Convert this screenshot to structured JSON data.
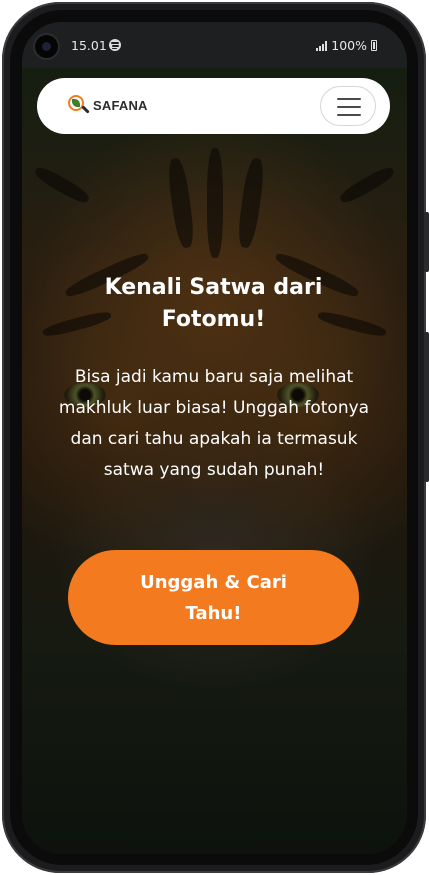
{
  "status_bar": {
    "time": "15.01",
    "battery": "100%",
    "icons": [
      "spotify-icon",
      "signal-icon",
      "battery-icon"
    ]
  },
  "navbar": {
    "logo_text": "SAFANA",
    "logo_icon": "magnifier-leaf-logo",
    "menu_icon": "hamburger-menu-icon"
  },
  "hero": {
    "title": "Kenali Satwa dari Fotomu!",
    "description": "Bisa jadi kamu baru saja melihat makhluk luar biasa! Unggah fotonya dan cari tahu apakah ia termasuk satwa yang sudah punah!",
    "cta_label": "Unggah & Cari Tahu!"
  },
  "colors": {
    "accent": "#f47a1f",
    "navbar_bg": "#ffffff",
    "text_on_image": "#ffffff"
  }
}
